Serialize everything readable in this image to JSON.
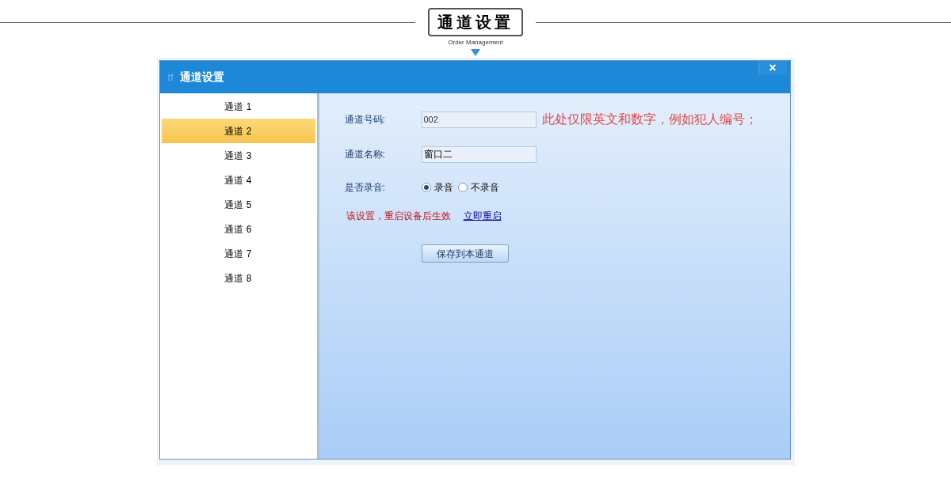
{
  "header": {
    "title": "通道设置",
    "subtitle": "Order Management"
  },
  "window": {
    "logo": "tf",
    "title": "通道设置",
    "close": "×"
  },
  "channels": [
    {
      "label": "通道 1",
      "selected": false
    },
    {
      "label": "通道 2",
      "selected": true
    },
    {
      "label": "通道 3",
      "selected": false
    },
    {
      "label": "通道 4",
      "selected": false
    },
    {
      "label": "通道 5",
      "selected": false
    },
    {
      "label": "通道 6",
      "selected": false
    },
    {
      "label": "通道 7",
      "selected": false
    },
    {
      "label": "通道 8",
      "selected": false
    }
  ],
  "form": {
    "code": {
      "label": "通道号码:",
      "value": "002",
      "hint": "此处仅限英文和数字，例如犯人编号；"
    },
    "name": {
      "label": "通道名称:",
      "value": "窗口二"
    },
    "record": {
      "label": "是否录音:",
      "options": [
        {
          "label": "录音",
          "selected": true
        },
        {
          "label": "不录音",
          "selected": false
        }
      ]
    },
    "notice": "该设置，重启设备后生效",
    "restart_link": "立即重启",
    "save_button": "保存到本通道"
  }
}
